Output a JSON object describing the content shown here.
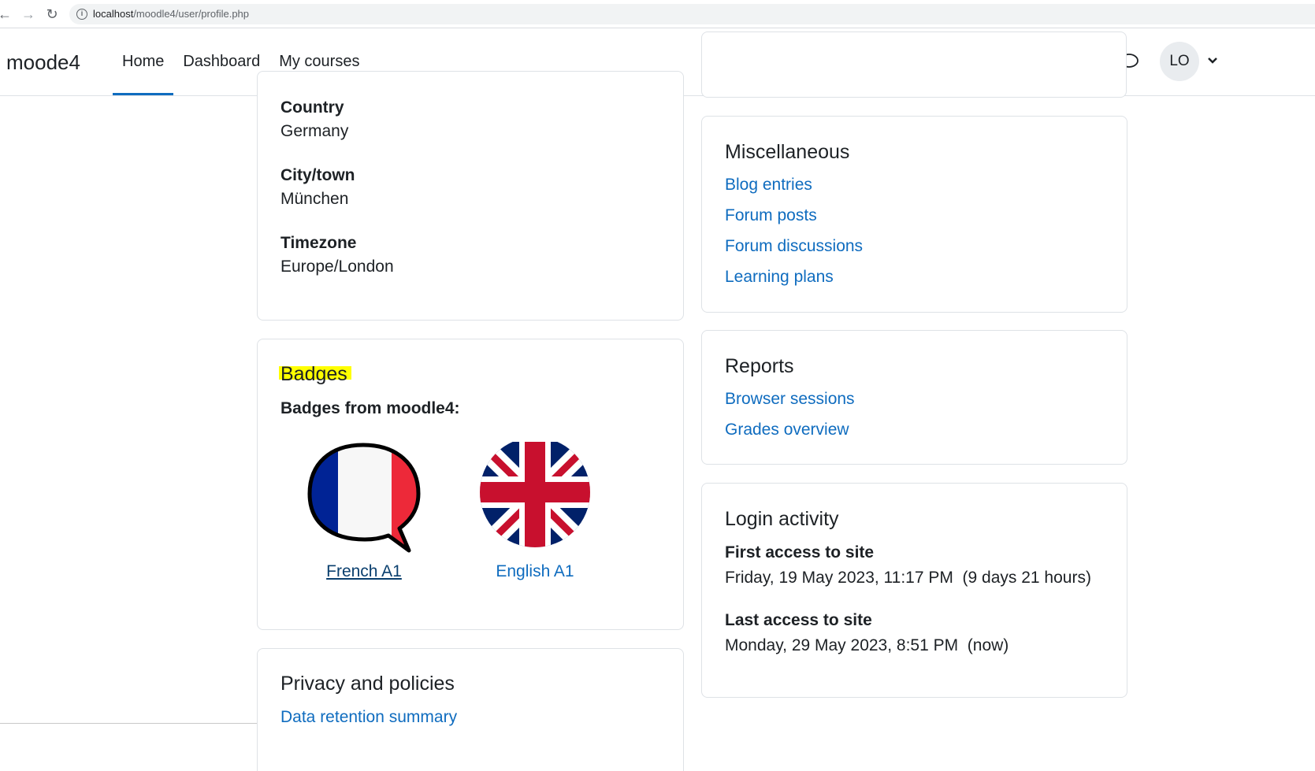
{
  "browser": {
    "url_host": "localhost",
    "url_path": "/moodle4/user/profile.php"
  },
  "navbar": {
    "brand": "moode4",
    "links": [
      {
        "label": "Home",
        "active": true
      },
      {
        "label": "Dashboard",
        "active": false
      },
      {
        "label": "My courses",
        "active": false
      }
    ],
    "avatar_initials": "LO"
  },
  "user_details": {
    "fields": [
      {
        "label": "Country",
        "value": "Germany"
      },
      {
        "label": "City/town",
        "value": "München"
      },
      {
        "label": "Timezone",
        "value": "Europe/London"
      }
    ]
  },
  "badges": {
    "title": "Badges",
    "subtitle": "Badges from moodle4:",
    "items": [
      {
        "label": "French A1",
        "icon": "french-flag-speech-bubble"
      },
      {
        "label": "English A1",
        "icon": "union-jack-circle"
      }
    ]
  },
  "privacy": {
    "title": "Privacy and policies",
    "link": "Data retention summary"
  },
  "miscellaneous": {
    "title": "Miscellaneous",
    "links": [
      "Blog entries",
      "Forum posts",
      "Forum discussions",
      "Learning plans"
    ]
  },
  "reports": {
    "title": "Reports",
    "links": [
      "Browser sessions",
      "Grades overview"
    ]
  },
  "login_activity": {
    "title": "Login activity",
    "first_access_label": "First access to site",
    "first_access_value": "Friday, 19 May 2023, 11:17 PM  (9 days 21 hours)",
    "last_access_label": "Last access to site",
    "last_access_value": "Monday, 29 May 2023, 8:51 PM  (now)"
  },
  "colors": {
    "link": "#0f6cbf",
    "active_underline": "#0f6cbf",
    "highlight": "#ffff00"
  }
}
